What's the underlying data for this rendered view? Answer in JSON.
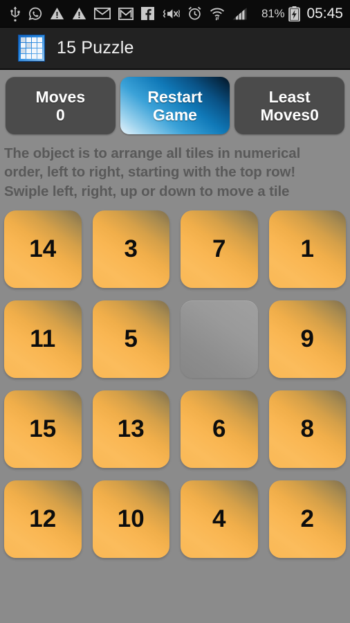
{
  "status_bar": {
    "icons": [
      {
        "name": "usb-icon",
        "label": "USB"
      },
      {
        "name": "whatsapp-icon",
        "label": "WhatsApp"
      },
      {
        "name": "warning-icon",
        "label": "Warning"
      },
      {
        "name": "warning-icon-2",
        "label": "Warning"
      },
      {
        "name": "mail-icon",
        "label": "Email"
      },
      {
        "name": "gmail-icon",
        "label": "Gmail"
      },
      {
        "name": "facebook-icon",
        "label": "Facebook"
      },
      {
        "name": "vibrate-mute-icon",
        "label": "Sound off / vibrate"
      },
      {
        "name": "alarm-clock-icon",
        "label": "Alarm"
      },
      {
        "name": "wifi-icon",
        "label": "Wi-Fi"
      },
      {
        "name": "cellular-signal-icon",
        "label": "Signal"
      }
    ],
    "battery_percent": "81%",
    "battery_state": "charging",
    "clock": "05:45"
  },
  "title_bar": {
    "app_icon": "puzzle-grid-icon",
    "title": "15 Puzzle"
  },
  "toolbar": {
    "moves_label": "Moves",
    "moves_value": "0",
    "restart_line1": "Restart",
    "restart_line2": "Game",
    "least_line1": "Least",
    "least_line2": "Moves0"
  },
  "instructions": {
    "line1": "The object is to arrange all tiles in numerical",
    "line2": "order, left to right, starting with the top row!",
    "line3": "Swiple left, right, up or down to move a tile"
  },
  "board": {
    "rows": 4,
    "cols": 4,
    "tiles": [
      "14",
      "3",
      "7",
      "1",
      "11",
      "5",
      "",
      "9",
      "15",
      "13",
      "6",
      "8",
      "12",
      "10",
      "4",
      "2"
    ],
    "empty_index": 6
  },
  "colors": {
    "background": "#8b8b8b",
    "status_bar": "#0b0b0b",
    "title_bar": "#222222",
    "button_dark": "#4b4b4b",
    "button_blue_accent": "#1079b8",
    "tile_orange": "#f9b652",
    "tile_empty": "#9a9a9a",
    "instruction_text": "#595959"
  }
}
